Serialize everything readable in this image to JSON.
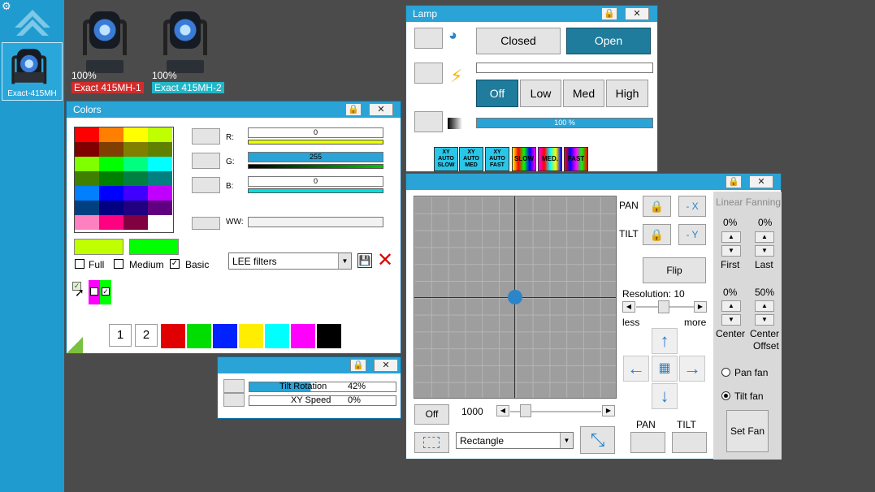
{
  "sidebar": {
    "fixture_label": "Exact-415MH"
  },
  "fixtures": [
    {
      "percent": "100%",
      "label": "Exact 415MH-1",
      "label_color": "#d32b2b"
    },
    {
      "percent": "100%",
      "label": "Exact 415MH-2",
      "label_color": "#22b6c8"
    }
  ],
  "colors_window": {
    "title": "Colors",
    "rgb": [
      {
        "label": "R:",
        "value": "0",
        "bar_color": "#e8ff00"
      },
      {
        "label": "G:",
        "value": "255",
        "bar_color": "#00c800"
      },
      {
        "label": "B:",
        "value": "0",
        "bar_color": "#00e0e0"
      }
    ],
    "ww_label": "WW:",
    "options": {
      "full": "Full",
      "medium": "Medium",
      "basic": "Basic"
    },
    "filter_select": "LEE filters",
    "preset_1": "1",
    "preset_2": "2",
    "grid_colors": [
      "#ff0000",
      "#ff7f00",
      "#ffff00",
      "#bfff00",
      "#800000",
      "#803f00",
      "#807f00",
      "#608000",
      "#7fff00",
      "#00ff00",
      "#00ff80",
      "#00ffff",
      "#3f8000",
      "#008000",
      "#008040",
      "#008080",
      "#0080ff",
      "#0000ff",
      "#3f00ff",
      "#bf00ff",
      "#004080",
      "#000080",
      "#200080",
      "#600080",
      "#ff80c0",
      "#ff0080",
      "#800040",
      "#ffffff"
    ],
    "selected_colors": [
      "#bfff00",
      "#00ff00"
    ],
    "palette": [
      "#e00000",
      "#00dd00",
      "#0022ff",
      "#ffee00",
      "#00ffff",
      "#ff00ff",
      "#000000"
    ]
  },
  "lamp_window": {
    "title": "Lamp",
    "shutter": {
      "closed": "Closed",
      "open": "Open"
    },
    "power": {
      "off": "Off",
      "low": "Low",
      "med": "Med",
      "high": "High"
    },
    "dimmer": "100 %",
    "macros": [
      "XY AUTO SLOW",
      "XY AUTO MED",
      "XY AUTO FAST",
      "SLOW",
      "MED.",
      "FAST"
    ]
  },
  "rotation_window": {
    "tilt_rotation": "Tilt Rotation",
    "tilt_rotation_value": "42%",
    "xy_speed": "XY Speed",
    "xy_speed_value": "0%"
  },
  "position_window": {
    "pan": "PAN",
    "tilt": "TILT",
    "invert_x": "- X",
    "invert_y": "- Y",
    "flip": "Flip",
    "resolution": "Resolution: 10",
    "less": "less",
    "more": "more",
    "off": "Off",
    "speed_value": "1000",
    "shape_select": "Rectangle",
    "pan_bottom": "PAN",
    "tilt_bottom": "TILT",
    "fanning": {
      "title": "Linear Fanning",
      "first_value": "0%",
      "last_value": "0%",
      "first": "First",
      "last": "Last",
      "center_value": "0%",
      "center_offset_value": "50%",
      "center": "Center",
      "center_offset_1": "Center",
      "center_offset_2": "Offset",
      "pan_fan": "Pan fan",
      "tilt_fan": "Tilt fan",
      "set_fan": "Set Fan"
    }
  }
}
